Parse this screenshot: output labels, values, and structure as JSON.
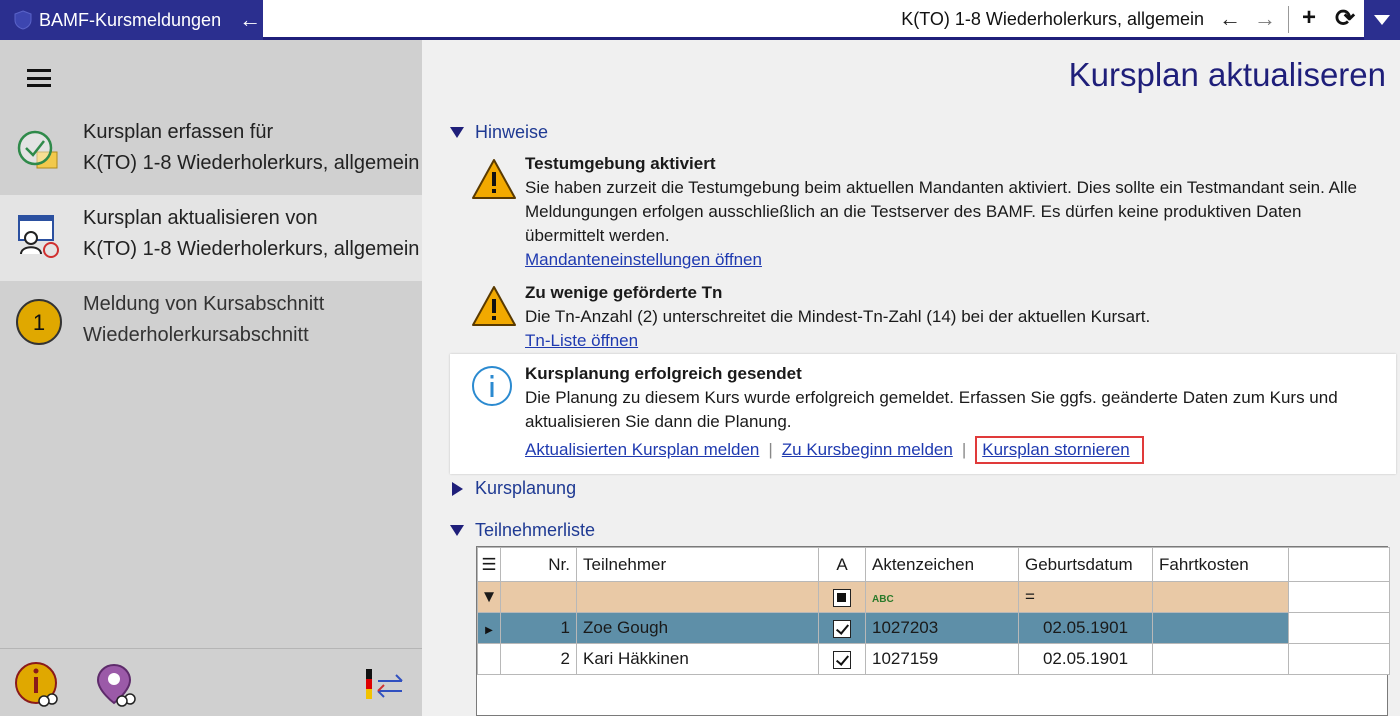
{
  "titlebar": {
    "app_title": "BAMF-Kursmeldungen",
    "course_title": "K(TO) 1-8 Wiederholerkurs, allgemein",
    "back_label": "←",
    "forward_label": "→",
    "add_label": "+",
    "refresh_label": "⟳"
  },
  "sidebar": {
    "items": [
      {
        "line1": "Kursplan erfassen für",
        "line2": "K(TO) 1-8 Wiederholerkurs, allgemein"
      },
      {
        "line1": "Kursplan aktualisieren von",
        "line2": "K(TO) 1-8 Wiederholerkurs, allgemein"
      },
      {
        "line1": "Meldung von Kursabschnitt",
        "line2": "Wiederholerkursabschnitt",
        "badge": "1"
      }
    ]
  },
  "main": {
    "page_title": "Kursplan aktualiseren",
    "sections": {
      "hinweise": "Hinweise",
      "kursplanung": "Kursplanung",
      "teilnehmerliste": "Teilnehmerliste"
    },
    "notices": [
      {
        "title": "Testumgebung aktiviert",
        "text": "Sie haben zurzeit die Testumgebung beim aktuellen Mandanten aktiviert. Dies sollte ein Testmandant sein. Alle Meldungungen erfolgen ausschließlich an die Testserver des BAMF. Es dürfen keine produktiven Daten übermittelt werden.",
        "link": "Mandanteneinstellungen öffnen"
      },
      {
        "title": "Zu wenige geförderte Tn",
        "text": "Die Tn-Anzahl (2) unterschreitet die Mindest-Tn-Zahl (14) bei der aktuellen Kursart.",
        "link": "Tn-Liste öffnen"
      }
    ],
    "info": {
      "title": "Kursplanung erfolgreich gesendet",
      "text": "Die Planung zu diesem Kurs wurde erfolgreich gemeldet. Erfassen Sie ggfs. geänderte Daten zum Kurs und aktualisieren Sie dann die Planung.",
      "links": [
        "Aktualisierten Kursplan melden",
        "Zu Kursbeginn melden",
        "Kursplan stornieren"
      ],
      "separator": "|"
    }
  },
  "grid": {
    "columns": [
      "",
      "Nr.",
      "Teilnehmer",
      "A",
      "Aktenzeichen",
      "Geburtsdatum",
      "Fahrtkosten",
      ""
    ],
    "filter_aktenzeichen_icon": "ABC",
    "filter_geburtsdatum": "=",
    "rows": [
      {
        "nr": "1",
        "name": "Zoe Gough",
        "a": true,
        "aktenzeichen": "1027203",
        "geburtsdatum": "02.05.1901",
        "fahrtkosten": ""
      },
      {
        "nr": "2",
        "name": "Kari Häkkinen",
        "a": true,
        "aktenzeichen": "1027159",
        "geburtsdatum": "02.05.1901",
        "fahrtkosten": ""
      }
    ]
  },
  "colors": {
    "accent": "#2b2f8f",
    "filter_row": "#e9c9a6",
    "selected_row": "#5e8fa8",
    "highlight_border": "#e03a3a"
  }
}
